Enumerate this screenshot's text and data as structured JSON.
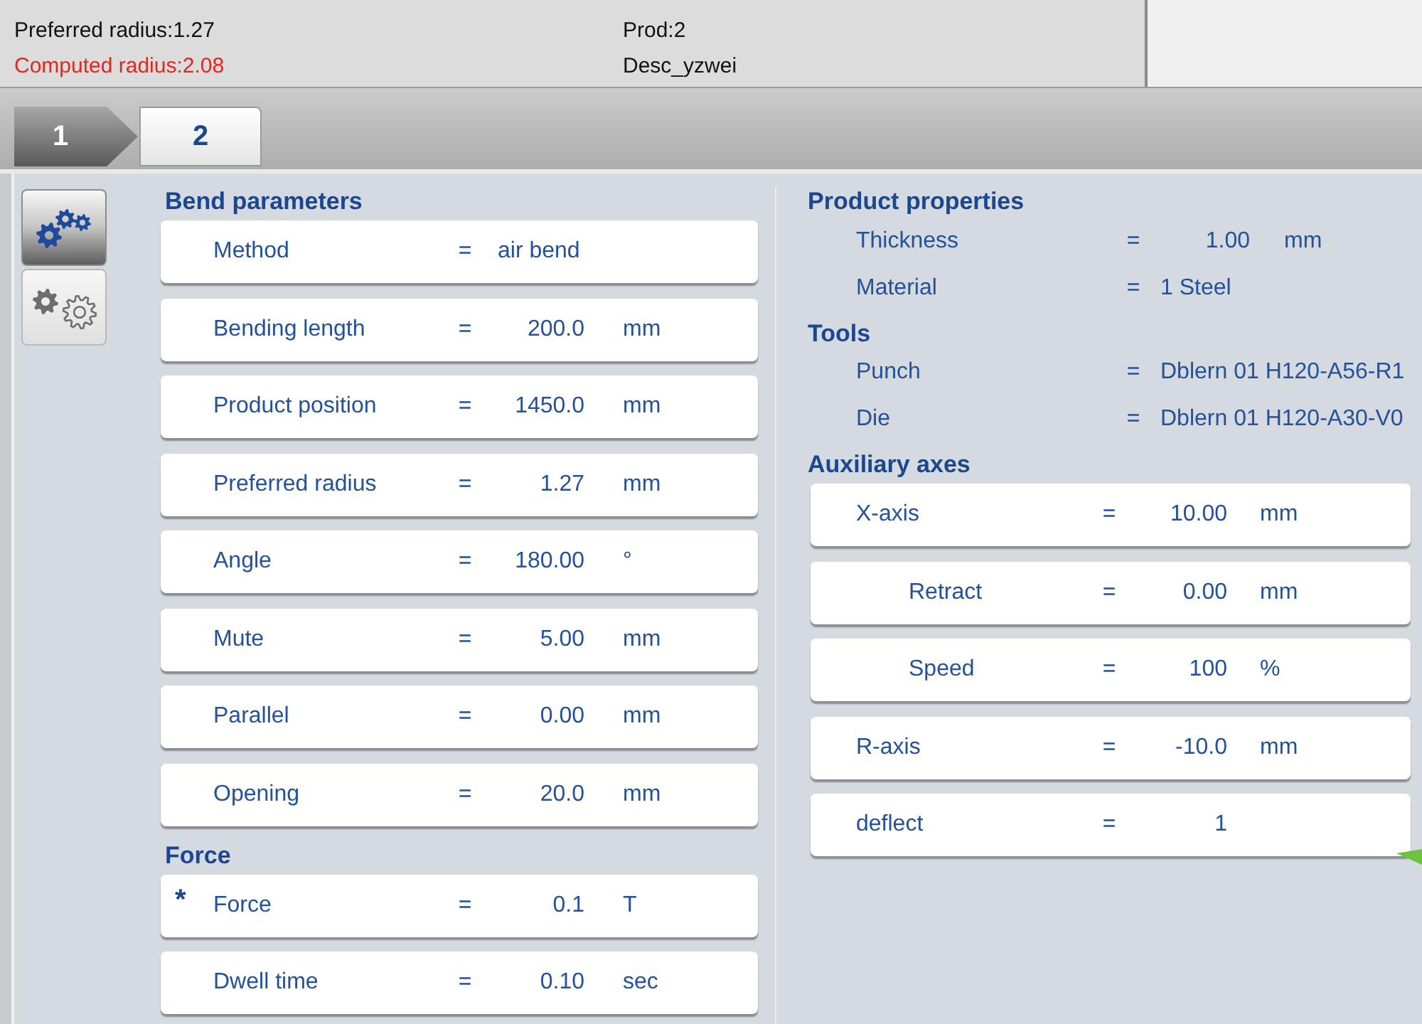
{
  "header": {
    "left_lines": [
      {
        "text": "Preferred radius:1.27",
        "kind": "normal"
      },
      {
        "text": "Computed radius:2.08",
        "kind": "alert"
      }
    ],
    "center_lines": [
      "Prod:2",
      "Desc_yzwei"
    ]
  },
  "tabs": [
    {
      "label": "1",
      "selected": false
    },
    {
      "label": "2",
      "selected": true
    }
  ],
  "side_buttons": [
    {
      "kind": "gear-set",
      "selected": true
    },
    {
      "kind": "gear-pair",
      "selected": false
    }
  ],
  "left_column": [
    {
      "title": "Bend parameters",
      "kind": "cards",
      "rows": [
        {
          "label": "Method",
          "sign": "=",
          "value": "air bend",
          "kind": "text"
        },
        {
          "label": "Bending length",
          "sign": "=",
          "value": "200.0",
          "unit": "mm",
          "kind": "number"
        },
        {
          "label": "Product position",
          "sign": "=",
          "value": "1450.0",
          "unit": "mm",
          "kind": "number"
        },
        {
          "label": "Preferred radius",
          "sign": "=",
          "value": "1.27",
          "unit": "mm",
          "kind": "number"
        },
        {
          "label": "Angle",
          "sign": "=",
          "value": "180.00",
          "unit": "°",
          "kind": "number"
        },
        {
          "label": "Mute",
          "sign": "=",
          "value": "5.00",
          "unit": "mm",
          "kind": "number"
        },
        {
          "label": "Parallel",
          "sign": "=",
          "value": "0.00",
          "unit": "mm",
          "kind": "number"
        },
        {
          "label": "Opening",
          "sign": "=",
          "value": "20.0",
          "unit": "mm",
          "kind": "number"
        }
      ]
    },
    {
      "title": "Force",
      "kind": "cards",
      "rows": [
        {
          "marker": "*",
          "label": "Force",
          "sign": "=",
          "value": "0.1",
          "unit": "T",
          "kind": "number"
        },
        {
          "label": "Dwell time",
          "sign": "=",
          "value": "0.10",
          "unit": "sec",
          "kind": "number"
        }
      ]
    }
  ],
  "right_column": [
    {
      "title": "Product properties",
      "kind": "plain",
      "rows": [
        {
          "label": "Thickness",
          "sign": "=",
          "value": "1.00",
          "unit": "mm",
          "kind": "number"
        },
        {
          "label": "Material",
          "sign": "=",
          "value": "1 Steel",
          "kind": "text"
        }
      ]
    },
    {
      "title": "Tools",
      "kind": "plain",
      "rows": [
        {
          "label": "Punch",
          "sign": "=",
          "value": "Dblern 01 H120-A56-R1",
          "kind": "text"
        },
        {
          "label": "Die",
          "sign": "=",
          "value": "Dblern 01 H120-A30-V0",
          "kind": "text"
        }
      ]
    },
    {
      "title": "Auxiliary axes",
      "kind": "cards",
      "rows": [
        {
          "label": "X-axis",
          "sign": "=",
          "value": "10.00",
          "unit": "mm",
          "kind": "number",
          "children": [
            {
              "label": "Retract",
              "sign": "=",
              "value": "0.00",
              "unit": "mm",
              "kind": "number"
            },
            {
              "label": "Speed",
              "sign": "=",
              "value": "100",
              "unit": "%",
              "kind": "number"
            }
          ]
        },
        {
          "label": "R-axis",
          "sign": "=",
          "value": "-10.0",
          "unit": "mm",
          "kind": "number"
        },
        {
          "label": "deflect",
          "sign": "=",
          "value": "1",
          "kind": "number"
        }
      ]
    }
  ]
}
